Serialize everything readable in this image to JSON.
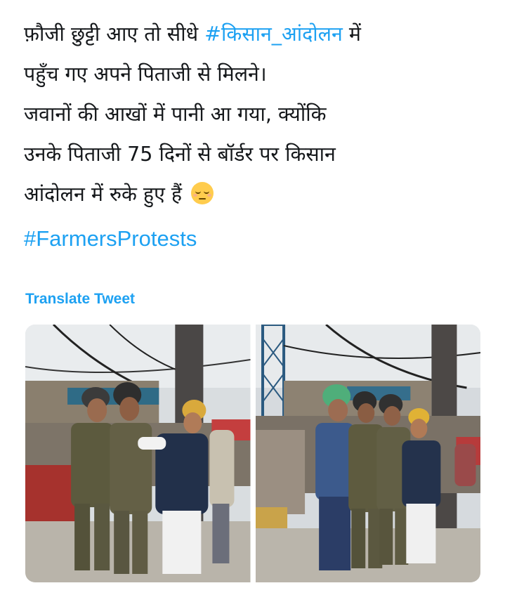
{
  "tweet": {
    "lines": [
      {
        "plain": "फ़ौजी छुट्टी आए तो सीधे ",
        "hashtag": "#किसान_आंदोलन",
        "after": " में"
      },
      {
        "plain": "पहुँच गए अपने पिताजी से मिलने।"
      },
      {
        "plain": "जवानों की आखों में पानी आ गया, क्योंकि"
      },
      {
        "plain": "उनके पिताजी 75 दिनों से बॉर्डर पर किसान"
      },
      {
        "plain": "आंदोलन में रुके हुए हैं"
      }
    ],
    "emoji": "pensive-face-emoji",
    "hashtag_line": "#FarmersProtests",
    "translate_label": "Translate Tweet",
    "accent_color": "#1da1f2",
    "text_color": "#14171a"
  },
  "media": {
    "photos": [
      {
        "name": "photo-left",
        "subject": "soldiers with man in navy vest at market"
      },
      {
        "name": "photo-right",
        "subject": "soldiers with turbaned men at market"
      }
    ]
  }
}
